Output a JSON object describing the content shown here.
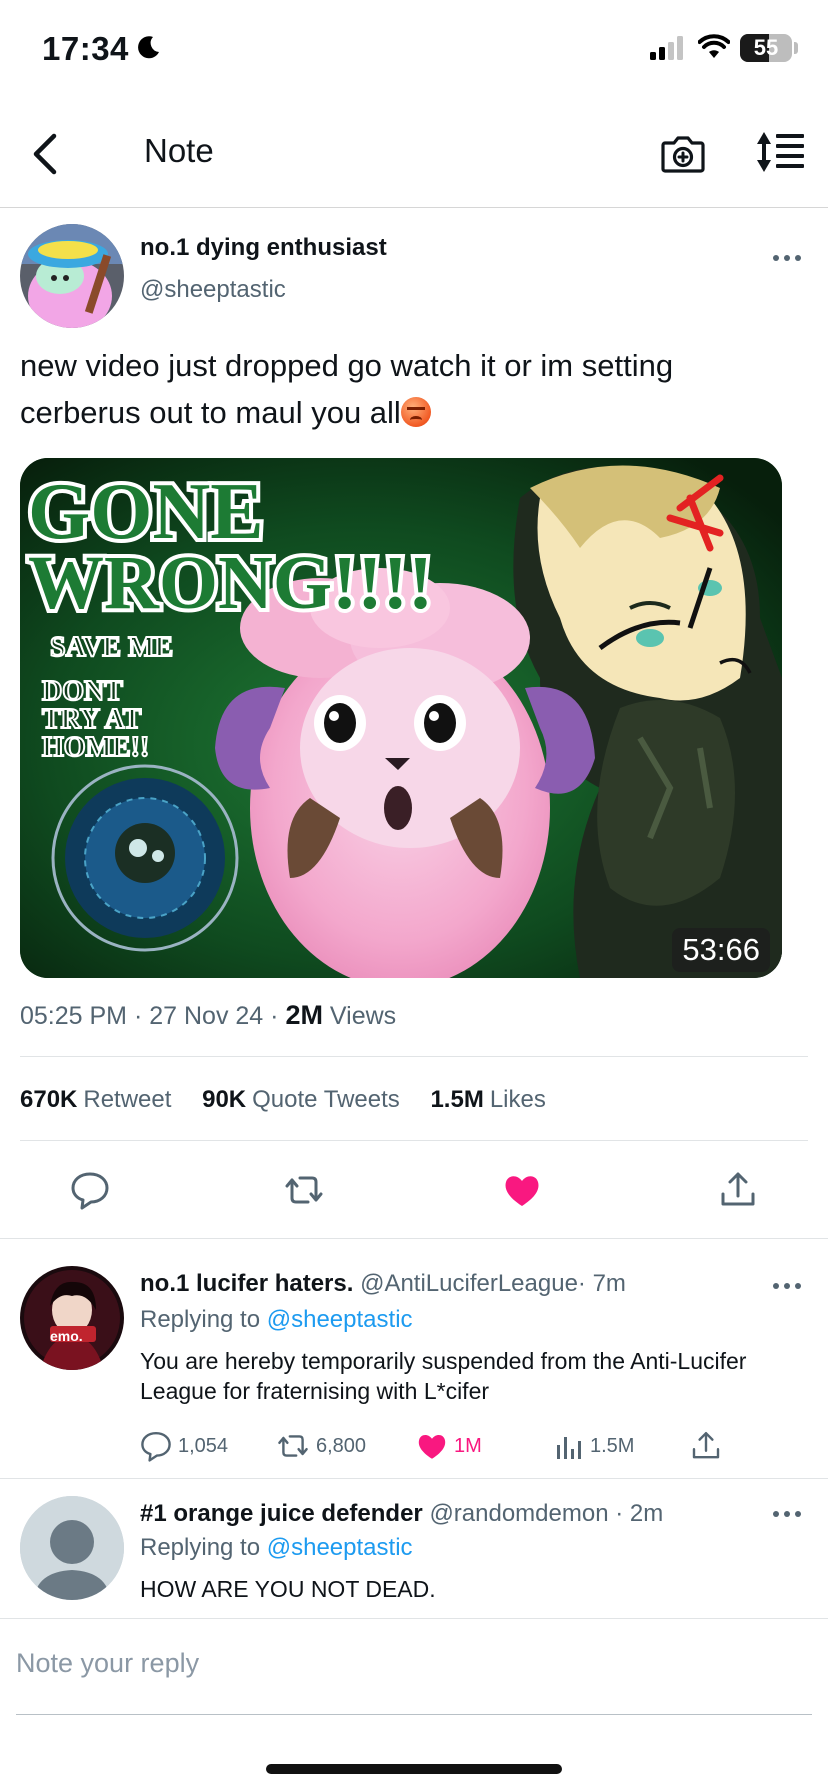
{
  "status_bar": {
    "time": "17:34",
    "battery": "55",
    "battery_level_percent": 55
  },
  "navbar": {
    "title": "Note",
    "back_icon": "chevron-left-icon",
    "camera_icon": "camera-plus-icon",
    "sort_icon": "sort-list-icon"
  },
  "post": {
    "display_name": "no.1 dying enthusiast",
    "handle": "@sheeptastic",
    "text": "new video just dropped go watch it or im setting cerberus out to maul you all",
    "emoji": "angry-face-emoji",
    "media": {
      "title_line1": "GONE",
      "title_line2": "WRONG!!!!",
      "caption1": "SAVE ME",
      "caption2": "DONT",
      "caption3": "TRY AT",
      "caption4": "HOME!!",
      "duration": "53:66"
    },
    "time": "05:25 PM",
    "date": "27 Nov 24",
    "views_count": "2M",
    "views_label": "Views",
    "retweets_count": "670K",
    "retweets_label": "Retweet",
    "quotes_count": "90K",
    "quotes_label": "Quote Tweets",
    "likes_count": "1.5M",
    "likes_label": "Likes",
    "liked": true,
    "accent_color": "#f91880"
  },
  "replies": [
    {
      "display_name": "no.1 lucifer haters.",
      "handle": "@AntiLuciferLeague",
      "time": "· 7m",
      "replying_label": "Replying to",
      "replying_to": "@sheeptastic",
      "text": "You are hereby temporarily suspended from the Anti-Lucifer League for  fraternising with L*cifer",
      "avatar_badge": "emo.",
      "replies": "1,054",
      "retweets": "6,800",
      "likes": "1M",
      "views": "1.5M",
      "liked": true
    },
    {
      "display_name": "#1 orange juice defender",
      "handle": "@randomdemon",
      "time": "· 2m",
      "replying_label": "Replying to",
      "replying_to": "@sheeptastic",
      "text": "HOW ARE YOU NOT DEAD."
    }
  ],
  "composer": {
    "placeholder": "Note your reply"
  },
  "colors": {
    "link": "#1d9bf0",
    "secondary_text": "#536471",
    "like": "#f91880"
  }
}
